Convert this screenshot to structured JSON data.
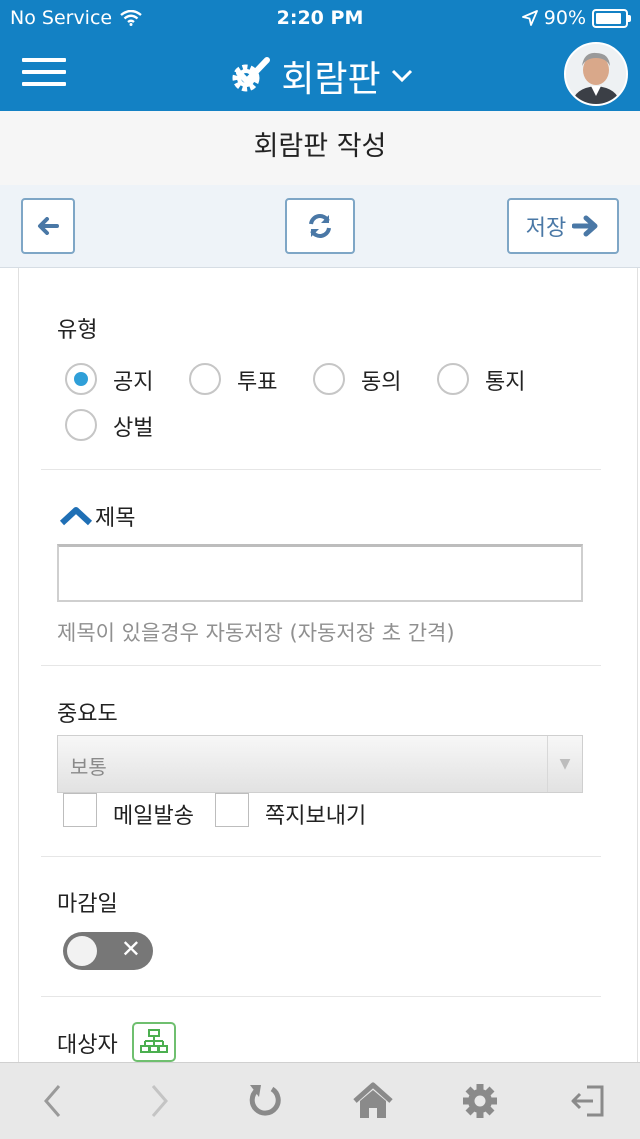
{
  "status_bar": {
    "carrier": "No Service",
    "time": "2:20 PM",
    "battery": "90%"
  },
  "app_bar": {
    "title": "회람판"
  },
  "page": {
    "title": "회람판 작성"
  },
  "toolbar": {
    "save_label": "저장"
  },
  "form": {
    "type": {
      "label": "유형",
      "options": [
        "공지",
        "투표",
        "동의",
        "통지",
        "상벌"
      ],
      "selected": "공지"
    },
    "subject": {
      "label": "제목",
      "value": "",
      "hint": "제목이 있을경우 자동저장 (자동저장 초 간격)"
    },
    "importance": {
      "label": "중요도",
      "selected": "보통",
      "checkboxes": [
        "메일발송",
        "쪽지보내기"
      ]
    },
    "deadline": {
      "label": "마감일",
      "enabled": false
    },
    "recipients": {
      "label": "대상자"
    }
  },
  "colors": {
    "brand_blue": "#1381c4",
    "radio_selected": "#2f9fd8",
    "toolbar_button_border": "#7ea6c6",
    "tree_icon": "#4caf50"
  },
  "icons": {
    "bottom_bar": [
      "back-icon",
      "forward-icon",
      "reload-icon",
      "home-icon",
      "settings-icon",
      "logout-icon"
    ]
  }
}
